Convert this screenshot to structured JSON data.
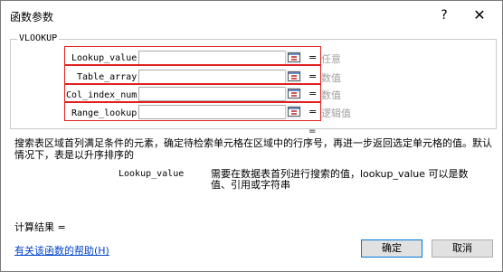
{
  "dialog": {
    "title": "函数参数",
    "help_glyph": "?",
    "close_glyph": "✕"
  },
  "function": {
    "name": "VLOOKUP",
    "args": [
      {
        "label": "Lookup_value",
        "value": "",
        "equals": "=",
        "hint": "任意"
      },
      {
        "label": "Table_array",
        "value": "",
        "equals": "=",
        "hint": "数值"
      },
      {
        "label": "Col_index_num",
        "value": "",
        "equals": "=",
        "hint": "数值"
      },
      {
        "label": "Range_lookup",
        "value": "",
        "equals": "=",
        "hint": "逻辑值"
      }
    ],
    "result_equals": "="
  },
  "description": {
    "main": "搜索表区域首列满足条件的元素，确定待检索单元格在区域中的行序号，再进一步返回选定单元格的值。默认情况下，表是以升序排序的",
    "param_name": "Lookup_value",
    "param_text": "需要在数据表首列进行搜索的值，lookup_value 可以是数值、引用或字符串"
  },
  "footer": {
    "calc_result": "计算结果 =",
    "help_link": "有关该函数的帮助(H)",
    "ok": "确定",
    "cancel": "取消"
  },
  "colors": {
    "highlight_border": "#e02020",
    "link": "#0044cc",
    "primary_button_border": "#0078d7"
  },
  "icons": {
    "help": "help-icon",
    "close": "close-icon",
    "range_select": "range-select-icon"
  }
}
